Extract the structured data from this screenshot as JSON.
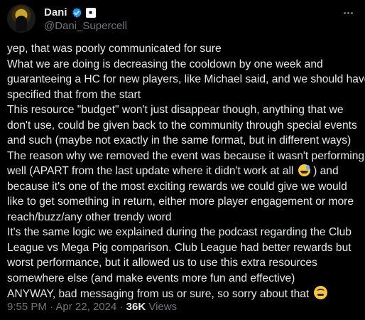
{
  "author": {
    "display_name": "Dani",
    "handle": "@Dani_Supercell",
    "verified_color": "#1d9bf0"
  },
  "tweet": {
    "lines": [
      "yep, that was poorly communicated for sure",
      "What we are doing is decreasing the cooldown by one week and",
      "guaranteeing a HC for new players, like Michael said, and we should have",
      "specified that from the start",
      "This resource \"budget\" won't just disappear though, anything that we",
      "don't use, could be given back to the community through special events",
      "and such (maybe not exactly in the same format, but in different ways)",
      "The reason why we removed the event was because it wasn't performing",
      "well (APART from the last update where it didn't work at all",
      "because it's one of the most exciting rewards we could give we would",
      "like to get something in return, either more player engagement or more",
      "reach/buzz/any other trendy word",
      "It's the same logic we explained during the podcast regarding the Club",
      "League vs Mega Pig comparison. Club League had better rewards but",
      "worst performance, but it allowed us to use this extra resources",
      "somewhere else (and make events more fun and effective)",
      "ANYWAY, bad messaging from us or sure, so sorry about that"
    ],
    "line9_suffix": ") and"
  },
  "meta": {
    "time": "9:55 PM",
    "separator": "·",
    "date": "Apr 22, 2024",
    "views_count": "36K",
    "views_label": "Views"
  }
}
